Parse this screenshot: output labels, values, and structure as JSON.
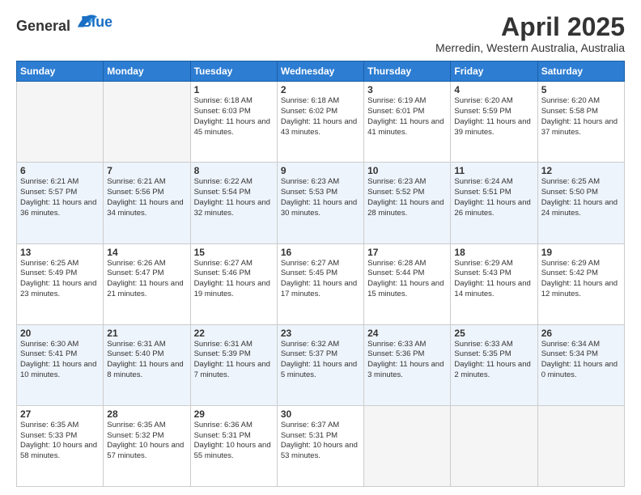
{
  "logo": {
    "line1": "General",
    "line2": "Blue"
  },
  "title": "April 2025",
  "subtitle": "Merredin, Western Australia, Australia",
  "days_of_week": [
    "Sunday",
    "Monday",
    "Tuesday",
    "Wednesday",
    "Thursday",
    "Friday",
    "Saturday"
  ],
  "weeks": [
    [
      {
        "day": "",
        "info": ""
      },
      {
        "day": "",
        "info": ""
      },
      {
        "day": "1",
        "info": "Sunrise: 6:18 AM\nSunset: 6:03 PM\nDaylight: 11 hours and 45 minutes."
      },
      {
        "day": "2",
        "info": "Sunrise: 6:18 AM\nSunset: 6:02 PM\nDaylight: 11 hours and 43 minutes."
      },
      {
        "day": "3",
        "info": "Sunrise: 6:19 AM\nSunset: 6:01 PM\nDaylight: 11 hours and 41 minutes."
      },
      {
        "day": "4",
        "info": "Sunrise: 6:20 AM\nSunset: 5:59 PM\nDaylight: 11 hours and 39 minutes."
      },
      {
        "day": "5",
        "info": "Sunrise: 6:20 AM\nSunset: 5:58 PM\nDaylight: 11 hours and 37 minutes."
      }
    ],
    [
      {
        "day": "6",
        "info": "Sunrise: 6:21 AM\nSunset: 5:57 PM\nDaylight: 11 hours and 36 minutes."
      },
      {
        "day": "7",
        "info": "Sunrise: 6:21 AM\nSunset: 5:56 PM\nDaylight: 11 hours and 34 minutes."
      },
      {
        "day": "8",
        "info": "Sunrise: 6:22 AM\nSunset: 5:54 PM\nDaylight: 11 hours and 32 minutes."
      },
      {
        "day": "9",
        "info": "Sunrise: 6:23 AM\nSunset: 5:53 PM\nDaylight: 11 hours and 30 minutes."
      },
      {
        "day": "10",
        "info": "Sunrise: 6:23 AM\nSunset: 5:52 PM\nDaylight: 11 hours and 28 minutes."
      },
      {
        "day": "11",
        "info": "Sunrise: 6:24 AM\nSunset: 5:51 PM\nDaylight: 11 hours and 26 minutes."
      },
      {
        "day": "12",
        "info": "Sunrise: 6:25 AM\nSunset: 5:50 PM\nDaylight: 11 hours and 24 minutes."
      }
    ],
    [
      {
        "day": "13",
        "info": "Sunrise: 6:25 AM\nSunset: 5:49 PM\nDaylight: 11 hours and 23 minutes."
      },
      {
        "day": "14",
        "info": "Sunrise: 6:26 AM\nSunset: 5:47 PM\nDaylight: 11 hours and 21 minutes."
      },
      {
        "day": "15",
        "info": "Sunrise: 6:27 AM\nSunset: 5:46 PM\nDaylight: 11 hours and 19 minutes."
      },
      {
        "day": "16",
        "info": "Sunrise: 6:27 AM\nSunset: 5:45 PM\nDaylight: 11 hours and 17 minutes."
      },
      {
        "day": "17",
        "info": "Sunrise: 6:28 AM\nSunset: 5:44 PM\nDaylight: 11 hours and 15 minutes."
      },
      {
        "day": "18",
        "info": "Sunrise: 6:29 AM\nSunset: 5:43 PM\nDaylight: 11 hours and 14 minutes."
      },
      {
        "day": "19",
        "info": "Sunrise: 6:29 AM\nSunset: 5:42 PM\nDaylight: 11 hours and 12 minutes."
      }
    ],
    [
      {
        "day": "20",
        "info": "Sunrise: 6:30 AM\nSunset: 5:41 PM\nDaylight: 11 hours and 10 minutes."
      },
      {
        "day": "21",
        "info": "Sunrise: 6:31 AM\nSunset: 5:40 PM\nDaylight: 11 hours and 8 minutes."
      },
      {
        "day": "22",
        "info": "Sunrise: 6:31 AM\nSunset: 5:39 PM\nDaylight: 11 hours and 7 minutes."
      },
      {
        "day": "23",
        "info": "Sunrise: 6:32 AM\nSunset: 5:37 PM\nDaylight: 11 hours and 5 minutes."
      },
      {
        "day": "24",
        "info": "Sunrise: 6:33 AM\nSunset: 5:36 PM\nDaylight: 11 hours and 3 minutes."
      },
      {
        "day": "25",
        "info": "Sunrise: 6:33 AM\nSunset: 5:35 PM\nDaylight: 11 hours and 2 minutes."
      },
      {
        "day": "26",
        "info": "Sunrise: 6:34 AM\nSunset: 5:34 PM\nDaylight: 11 hours and 0 minutes."
      }
    ],
    [
      {
        "day": "27",
        "info": "Sunrise: 6:35 AM\nSunset: 5:33 PM\nDaylight: 10 hours and 58 minutes."
      },
      {
        "day": "28",
        "info": "Sunrise: 6:35 AM\nSunset: 5:32 PM\nDaylight: 10 hours and 57 minutes."
      },
      {
        "day": "29",
        "info": "Sunrise: 6:36 AM\nSunset: 5:31 PM\nDaylight: 10 hours and 55 minutes."
      },
      {
        "day": "30",
        "info": "Sunrise: 6:37 AM\nSunset: 5:31 PM\nDaylight: 10 hours and 53 minutes."
      },
      {
        "day": "",
        "info": ""
      },
      {
        "day": "",
        "info": ""
      },
      {
        "day": "",
        "info": ""
      }
    ]
  ]
}
